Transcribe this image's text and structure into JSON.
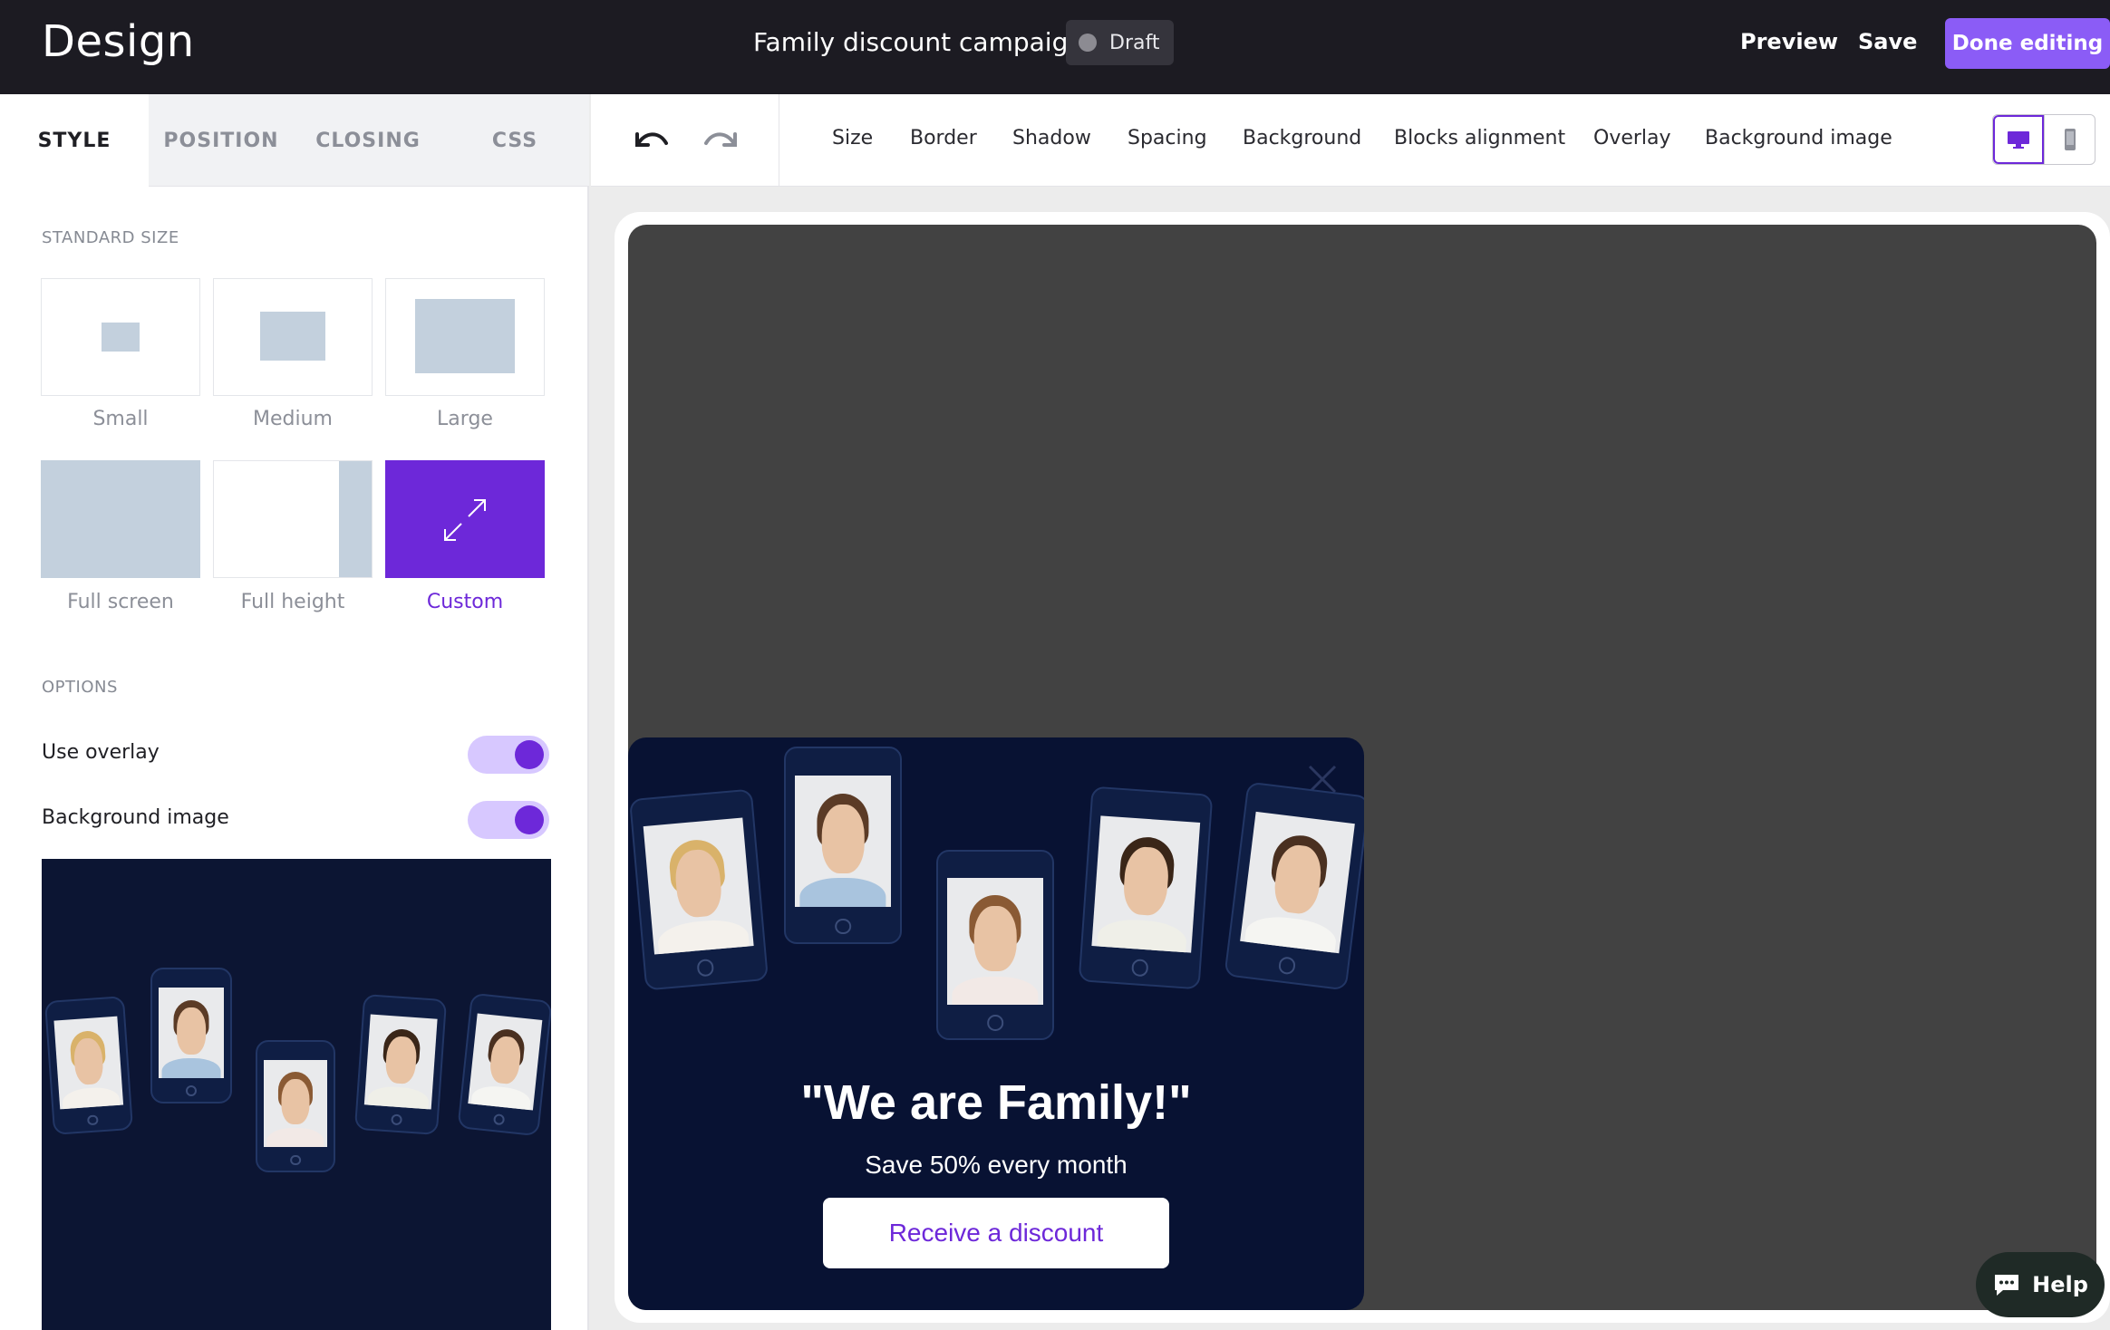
{
  "header": {
    "app_title": "Design",
    "campaign_name": "Family discount campaign",
    "status": "Draft",
    "preview_label": "Preview",
    "save_label": "Save",
    "done_label": "Done editing"
  },
  "tabs": [
    "STYLE",
    "POSITION",
    "CLOSING",
    "CSS"
  ],
  "style_panel": {
    "standard_size_label": "STANDARD SIZE",
    "sizes": [
      "Small",
      "Medium",
      "Large",
      "Full screen",
      "Full height",
      "Custom"
    ],
    "selected_size": "Custom",
    "options_label": "OPTIONS",
    "options": [
      {
        "label": "Use overlay",
        "on": true
      },
      {
        "label": "Background image",
        "on": true
      }
    ]
  },
  "toolbar": {
    "items": [
      "Size",
      "Border",
      "Shadow",
      "Spacing",
      "Background",
      "Blocks alignment",
      "Overlay",
      "Background image"
    ],
    "selected_device": "desktop"
  },
  "popup": {
    "title": "\"We are Family!\"",
    "subtitle": "Save 50% every month",
    "cta": "Receive a discount"
  },
  "help_label": "Help",
  "colors": {
    "accent": "#6d28d9",
    "done_button": "#8b5cf6",
    "popup_background": "#081233",
    "topbar": "#1c1b22"
  }
}
